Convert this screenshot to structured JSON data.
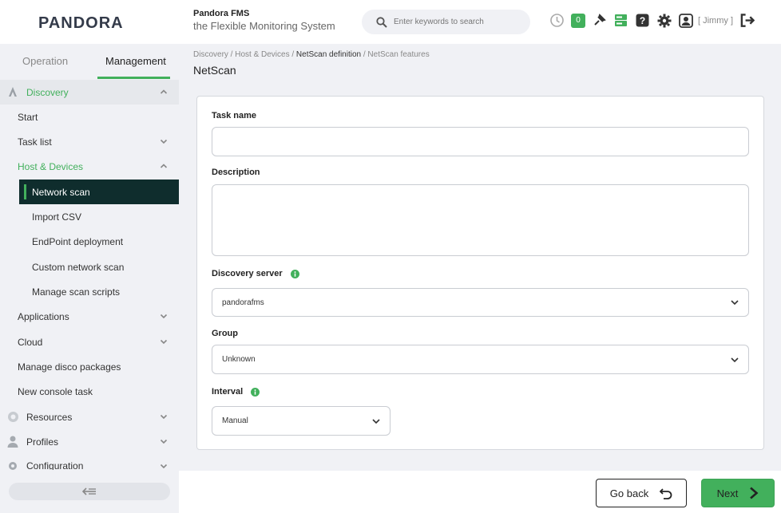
{
  "header": {
    "logo_text": "PANDORA",
    "brand_title": "Pandora FMS",
    "brand_subtitle": "the Flexible Monitoring System",
    "search_placeholder": "Enter keywords to search",
    "notification_count": "0",
    "user_label": "[ Jimmy ]"
  },
  "sidebar": {
    "tabs": [
      "Operation",
      "Management"
    ],
    "items": {
      "discovery": "Discovery",
      "start": "Start",
      "task_list": "Task list",
      "host_devices": "Host & Devices",
      "network_scan": "Network scan",
      "import_csv": "Import CSV",
      "endpoint": "EndPoint deployment",
      "custom_scan": "Custom network scan",
      "manage_scripts": "Manage scan scripts",
      "applications": "Applications",
      "cloud": "Cloud",
      "disco_packages": "Manage disco packages",
      "console_task": "New console task",
      "resources": "Resources",
      "profiles": "Profiles",
      "configuration": "Configuration"
    }
  },
  "breadcrumb": {
    "part1": "Discovery / Host & Devices / ",
    "current": "NetScan definition",
    "part3": " / NetScan features"
  },
  "page_title": "NetScan",
  "form": {
    "task_name_label": "Task name",
    "task_name_value": "",
    "description_label": "Description",
    "description_value": "",
    "server_label": "Discovery server",
    "server_value": "pandorafms",
    "group_label": "Group",
    "group_value": "Unknown",
    "interval_label": "Interval",
    "interval_value": "Manual"
  },
  "footer": {
    "back_label": "Go back",
    "next_label": "Next"
  },
  "colors": {
    "accent": "#42b05c",
    "active_bg": "#0f2d2d"
  }
}
